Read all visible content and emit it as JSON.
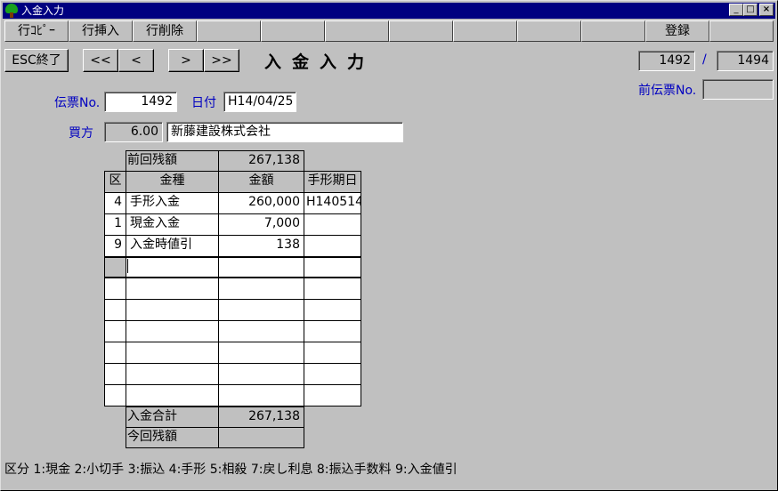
{
  "window": {
    "title": "入金入力"
  },
  "toolbar": {
    "copy_row": "行ｺﾋﾟｰ",
    "insert_row": "行挿入",
    "delete_row": "行削除",
    "register": "登録"
  },
  "nav": {
    "esc": "ESC終了",
    "first": "<<",
    "prev": "<",
    "next": ">",
    "last": ">>"
  },
  "screen_title": "入金入力",
  "record": {
    "current": "1492",
    "separator": "/",
    "total": "1494"
  },
  "header": {
    "voucher_label": "伝票No.",
    "voucher_no": "1492",
    "date_label": "日付",
    "date": "H14/04/25",
    "prev_voucher_label": "前伝票No.",
    "prev_voucher": "",
    "buyer_label": "買方",
    "buyer_code": "6.00",
    "buyer_name": "新藤建設株式会社"
  },
  "grid": {
    "prev_balance_label": "前回残額",
    "prev_balance": "267,138",
    "columns": [
      "区",
      "金種",
      "金額",
      "手形期日"
    ],
    "rows": [
      {
        "kubun": "4",
        "kind": "手形入金",
        "amount": "260,000",
        "due": "H140514"
      },
      {
        "kubun": "1",
        "kind": "現金入金",
        "amount": "7,000",
        "due": ""
      },
      {
        "kubun": "9",
        "kind": "入金時値引",
        "amount": "138",
        "due": ""
      },
      {
        "kubun": "",
        "kind": "",
        "amount": "",
        "due": ""
      }
    ],
    "total_label": "入金合計",
    "total": "267,138",
    "current_balance_label": "今回残額",
    "current_balance": ""
  },
  "legend": "区分 1:現金 2:小切手 3:振込 4:手形 5:相殺 7:戻し利息 8:振込手数料 9:入金値引"
}
